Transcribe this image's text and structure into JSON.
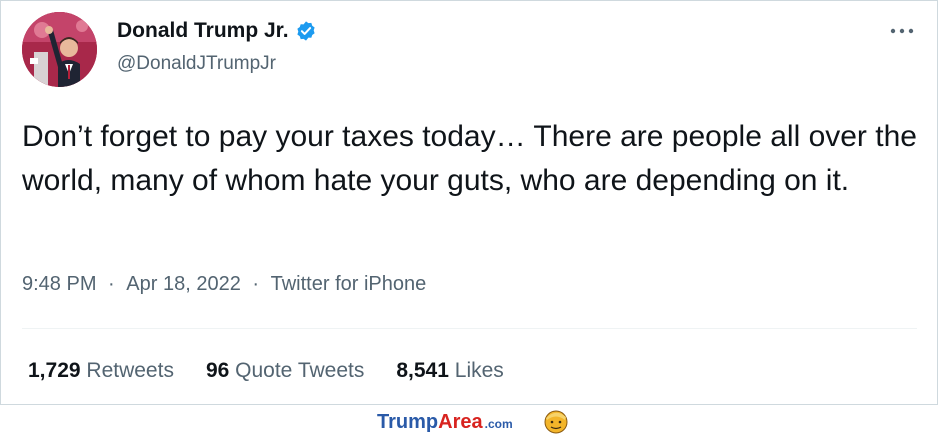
{
  "tweet": {
    "author_name": "Donald Trump Jr.",
    "handle": "@DonaldJTrumpJr",
    "text": "Don’t forget to pay your taxes today… There are people all over the world, many of whom hate your guts, who are depending on it.",
    "time": "9:48 PM",
    "separator": "·",
    "date": "Apr 18, 2022",
    "source": "Twitter for iPhone",
    "verified_icon": "verified-badge-icon",
    "more_icon": "more-options-icon",
    "colors": {
      "text": "#0f1419",
      "secondary": "#536471",
      "verified": "#1d9bf0",
      "border": "#cfd9de"
    }
  },
  "stats": {
    "retweets": {
      "count": "1,729",
      "label": "Retweets"
    },
    "quotes": {
      "count": "96",
      "label": "Quote Tweets"
    },
    "likes": {
      "count": "8,541",
      "label": "Likes"
    }
  },
  "watermark": {
    "brand_part1": "Trump",
    "brand_part2": "Area",
    "brand_suffix": ".com",
    "logo_icon": "trump-face-logo-icon"
  }
}
